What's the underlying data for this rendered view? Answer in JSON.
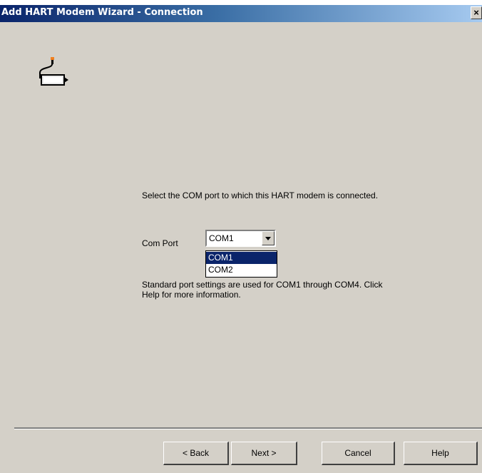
{
  "window": {
    "title": "Add HART Modem Wizard - Connection",
    "close_label": "×"
  },
  "icon": "hart-modem-icon",
  "content": {
    "instruction": "Select the COM port to which this HART modem is connected.",
    "com_port_label": "Com Port",
    "com_port_value": "COM1",
    "options": [
      "COM1",
      "COM2"
    ],
    "note": "Standard port settings are used for COM1 through COM4.  Click Help for more information."
  },
  "buttons": {
    "back": "< Back",
    "next": "Next >",
    "cancel": "Cancel",
    "help": "Help"
  },
  "colors": {
    "dialog_bg": "#d4d0c8",
    "titlebar_start": "#0a246a",
    "titlebar_end": "#a6caf0",
    "selection": "#0a246a"
  }
}
